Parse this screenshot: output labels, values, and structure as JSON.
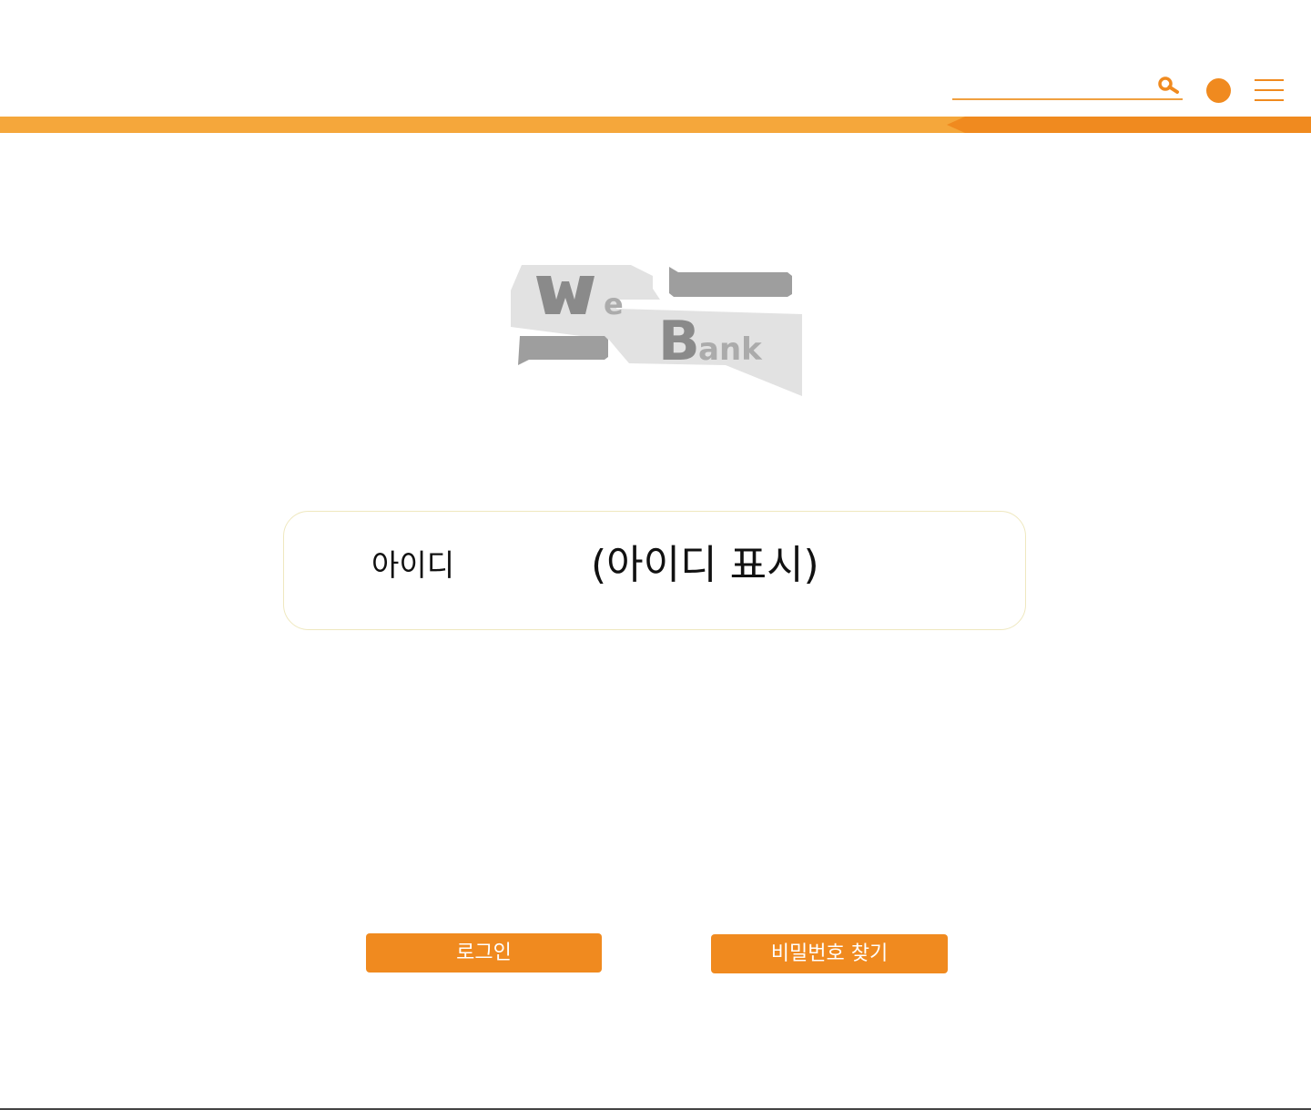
{
  "header": {
    "search": {
      "placeholder": "",
      "value": ""
    },
    "icons": {
      "search": "search-icon",
      "profile": "profile-icon",
      "menu": "hamburger-menu-icon"
    }
  },
  "logo": {
    "brand": "WeBank",
    "icon": "webank-logo"
  },
  "account": {
    "id_label": "아이디",
    "id_value": "(아이디 표시)"
  },
  "actions": {
    "login_label": "로그인",
    "find_password_label": "비밀번호 찾기"
  },
  "colors": {
    "accent": "#f08a1f",
    "accent_light": "#f5a73b",
    "logo_gray_dark": "#8a8a8a",
    "logo_gray_light": "#e2e2e2",
    "card_border": "#efe8bf",
    "button_text": "#ffffff"
  }
}
